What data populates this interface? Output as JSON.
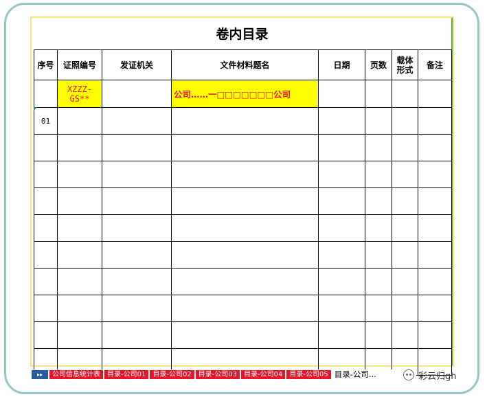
{
  "title": "卷内目录",
  "headers": [
    "序号",
    "证照编号",
    "发证机关",
    "文件材料题名",
    "日期",
    "页数",
    "载体形式",
    "备注"
  ],
  "highlight_row": {
    "seq": "",
    "code": "XZZZ-GS**",
    "issuer": "",
    "doc_title": "公司……一□□□□□□□公司",
    "date": "",
    "pages": "",
    "medium": "",
    "remark": ""
  },
  "data_rows": [
    {
      "seq": "01"
    },
    {
      "seq": ""
    },
    {
      "seq": ""
    },
    {
      "seq": ""
    },
    {
      "seq": ""
    },
    {
      "seq": ""
    },
    {
      "seq": ""
    },
    {
      "seq": ""
    },
    {
      "seq": ""
    },
    {
      "seq": ""
    }
  ],
  "sheet_tabs": [
    {
      "label": "公司信息统计表",
      "active": false
    },
    {
      "label": "目录-公司01",
      "active": false
    },
    {
      "label": "目录-公司02",
      "active": false
    },
    {
      "label": "目录-公司03",
      "active": false
    },
    {
      "label": "目录-公司04",
      "active": false
    },
    {
      "label": "目录-公司05",
      "active": false
    },
    {
      "label": "目录-公司...",
      "active": true
    }
  ],
  "nav_arrows": "▸▸",
  "watermark": "彩云归gh",
  "colors": {
    "frame": "#8fc8c4",
    "highlight": "#ffff00",
    "red_text": "#e8142a",
    "tab_red": "#e8142a",
    "grid_edge": "#58b04a"
  }
}
